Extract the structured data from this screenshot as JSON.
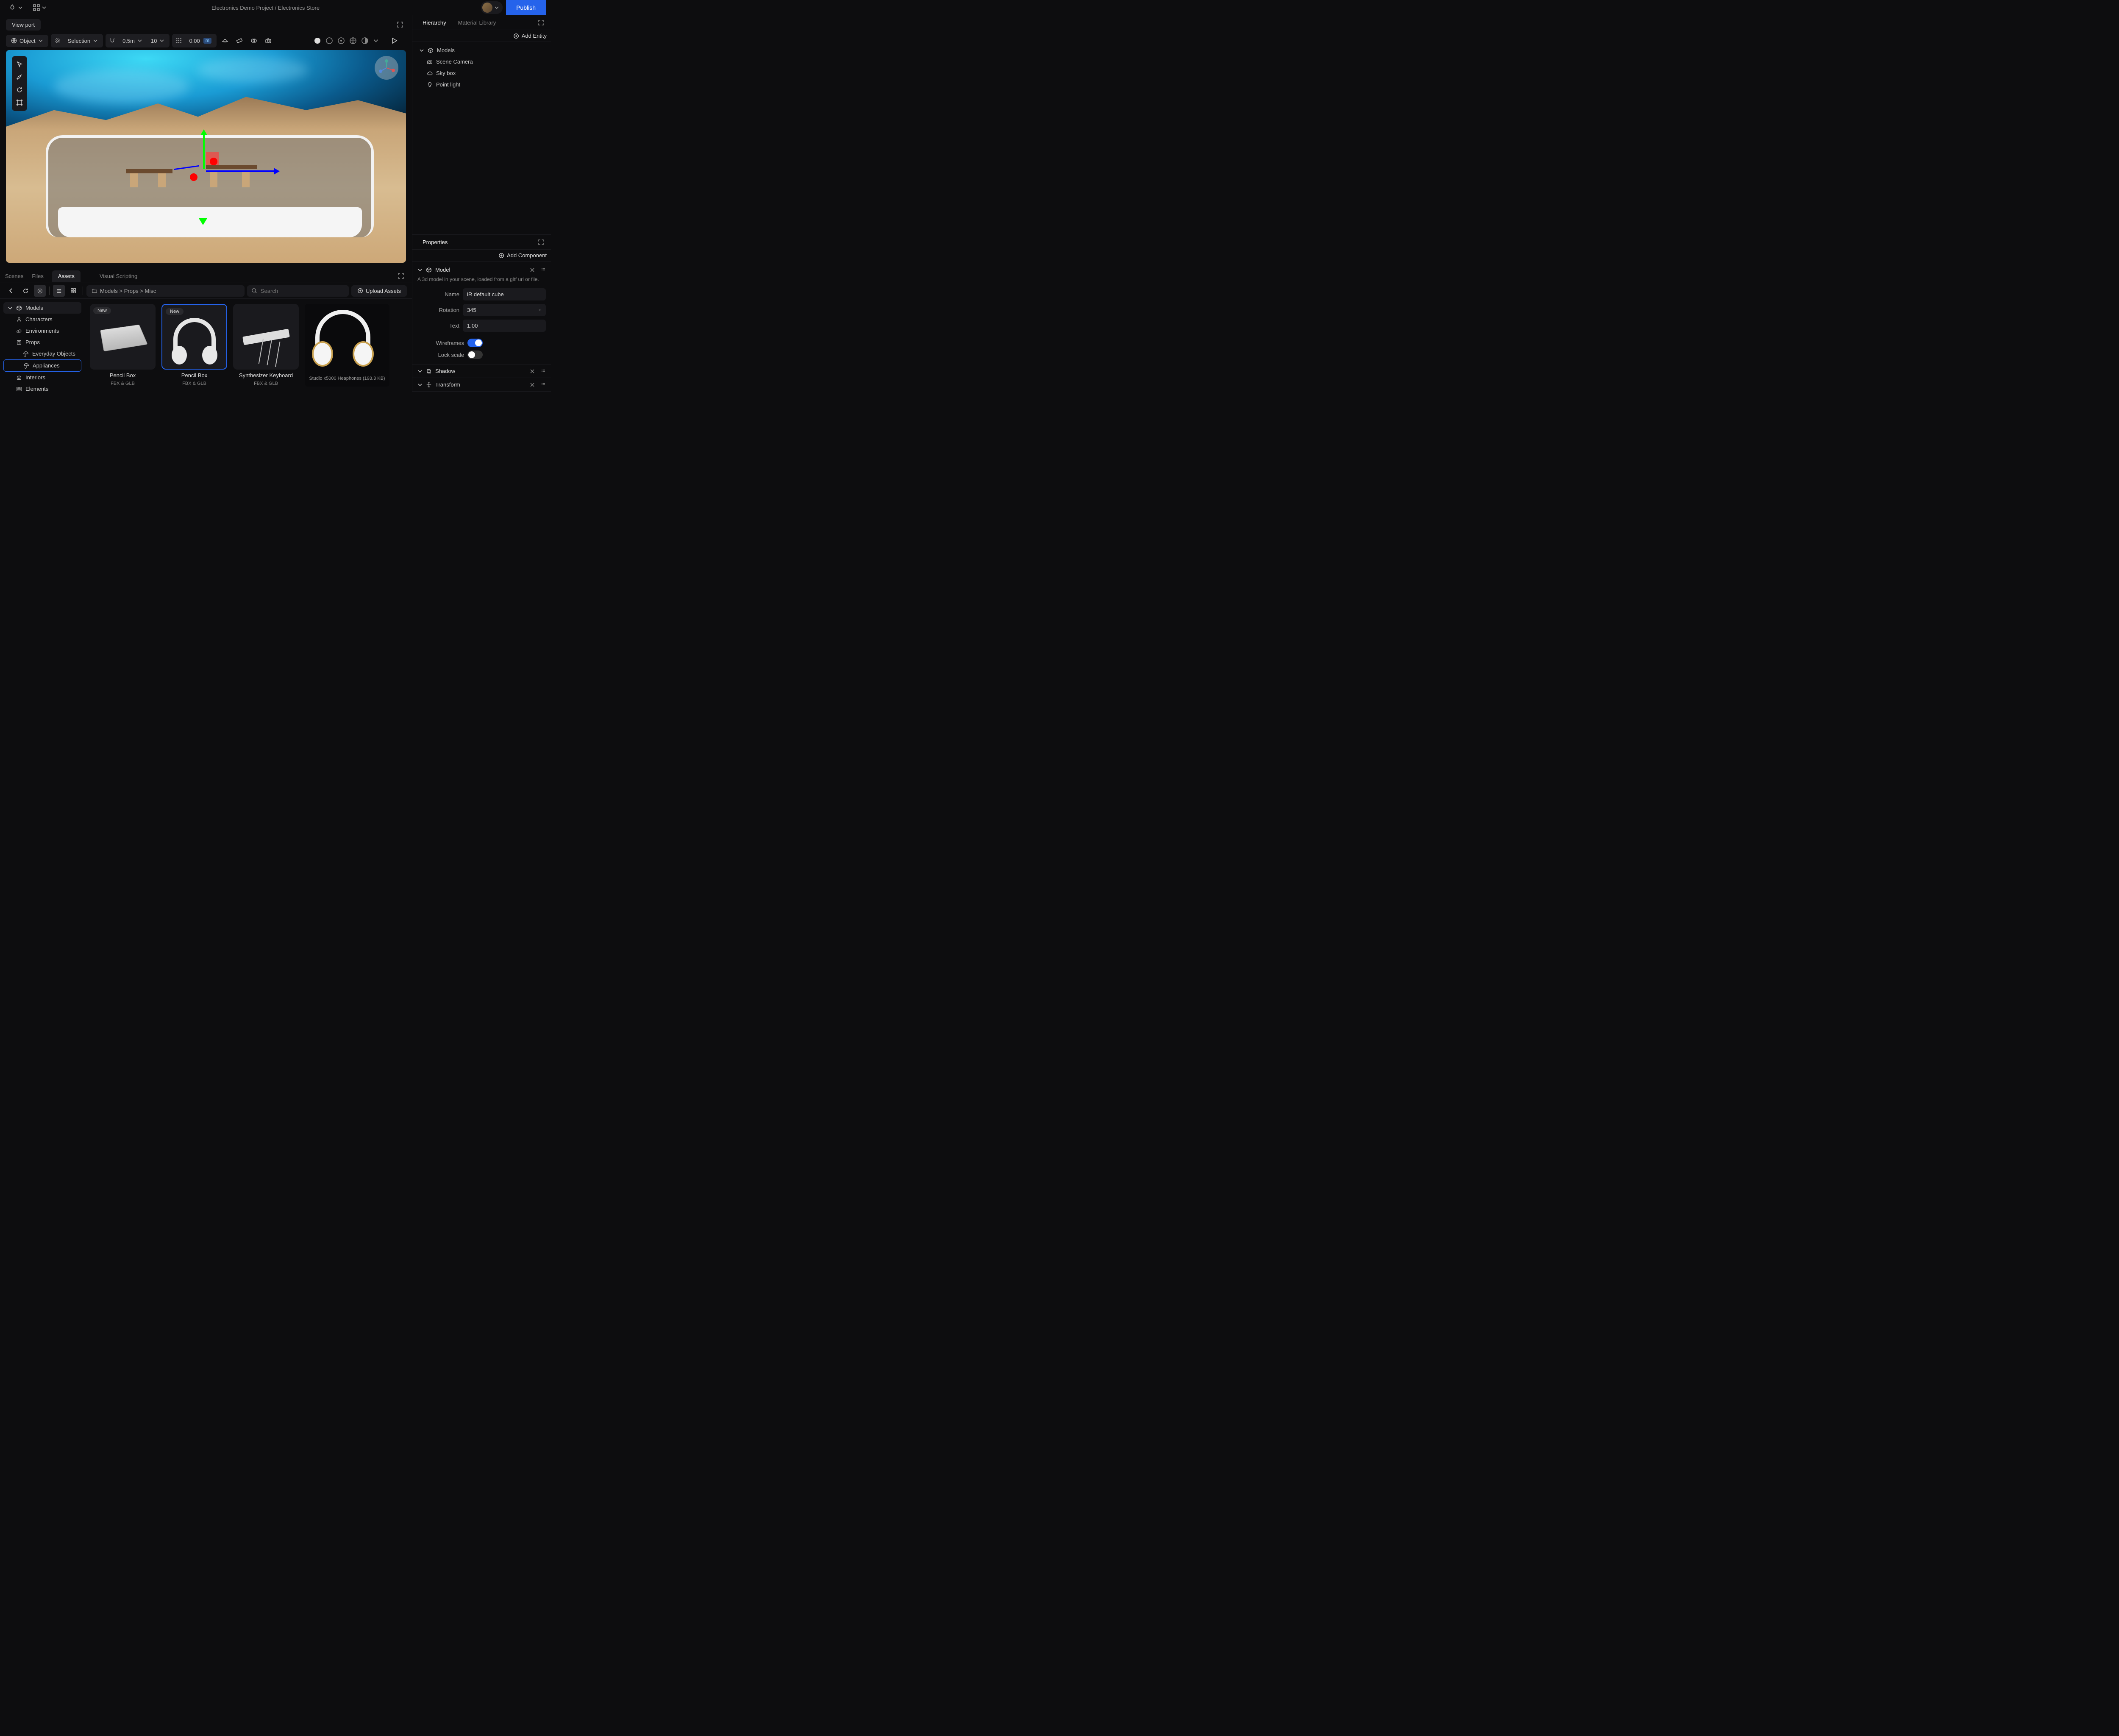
{
  "breadcrumb": "Electronics Demo Project / Electronics Store",
  "publish_label": "Publish",
  "viewport_tab": "View port",
  "toolbar": {
    "object_label": "Object",
    "selection_label": "Selection",
    "snap_value": "0.5m",
    "snap_angle": "10",
    "value": "0.00",
    "unit": "m"
  },
  "hierarchy": {
    "tab1": "Hierarchy",
    "tab2": "Material Library",
    "add_entity": "Add Entity",
    "items": {
      "models": "Models",
      "camera": "Scene Camera",
      "skybox": "Sky box",
      "light": "Point light"
    }
  },
  "properties": {
    "tab": "Properties",
    "add_component": "Add Component",
    "model": {
      "title": "Model",
      "desc": "A 3d model in your scene, loaded from a gltf url or file.",
      "name_label": "Name",
      "name_value": "iR default cube",
      "rotation_label": "Rotation",
      "rotation_value": "345",
      "text_label": "Text",
      "text_value": "1.00",
      "wireframes_label": "Wireframes",
      "lockscale_label": "Lock scale"
    },
    "shadow_title": "Shadow",
    "transform_title": "Transform"
  },
  "bottom": {
    "tabs": {
      "scenes": "Scenes",
      "files": "Files",
      "assets": "Assets",
      "vs": "Visual Scripting"
    },
    "breadcrumb": "Models > Props > Misc",
    "search_placeholder": "Search",
    "upload": "Upload Assets",
    "tree": {
      "models": "Models",
      "characters": "Characters",
      "environments": "Environments",
      "props": "Props",
      "everyday": "Everyday Objects",
      "appliances": "Appliances",
      "interiors": "Interiors",
      "elements": "Elements"
    },
    "cards": [
      {
        "name": "Pencil Box",
        "sub": "FBX & GLB",
        "badge": "New"
      },
      {
        "name": "Pencil Box",
        "sub": "FBX & GLB",
        "badge": "New"
      },
      {
        "name": "Synthesizer Keyboard",
        "sub": "FBX & GLB"
      }
    ],
    "preview_caption": "Studio x5000 Heaphones (193.3 KB)"
  }
}
